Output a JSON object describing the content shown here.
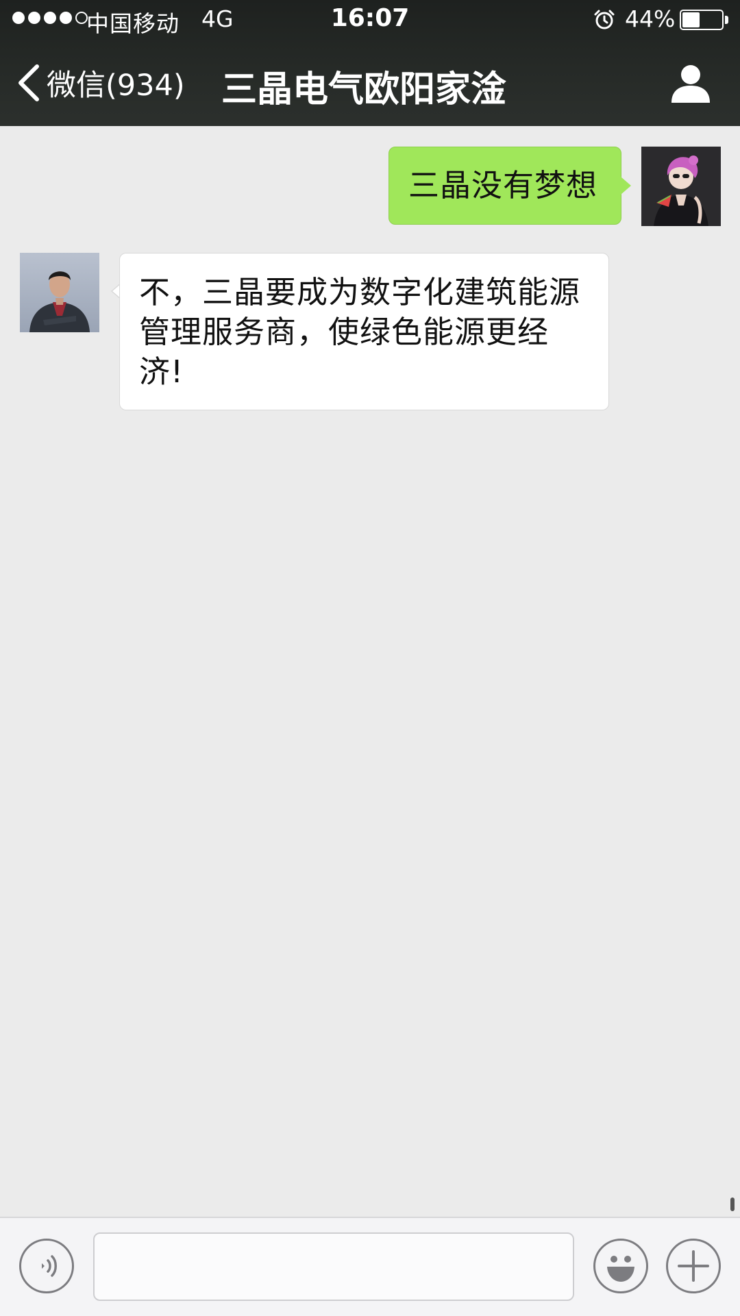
{
  "status_bar": {
    "carrier": "中国移动",
    "network": "4G",
    "time": "16:07",
    "battery_percent_label": "44%",
    "battery_level": 0.44,
    "signal_bars_filled": 4,
    "signal_bars_total": 5
  },
  "nav": {
    "back_label": "微信(934)",
    "title": "三晶电气欧阳家淦"
  },
  "messages": [
    {
      "direction": "sent",
      "text": "三晶没有梦想"
    },
    {
      "direction": "received",
      "lines": [
        "不，三晶要成为数字化建筑能源",
        "管理服务商，使绿色能源更经",
        "济!"
      ]
    }
  ],
  "input": {
    "value": "",
    "placeholder": ""
  },
  "icons": {
    "back": "chevron-left-icon",
    "contact": "person-icon",
    "alarm": "alarm-clock-icon",
    "voice": "voice-icon",
    "emoji": "smiley-icon",
    "more": "plus-icon"
  },
  "colors": {
    "sent_bubble": "#a0e75a",
    "received_bubble": "#ffffff",
    "chat_background": "#ebebeb",
    "header_background": "#262a27",
    "input_bar_background": "#f4f4f6"
  }
}
